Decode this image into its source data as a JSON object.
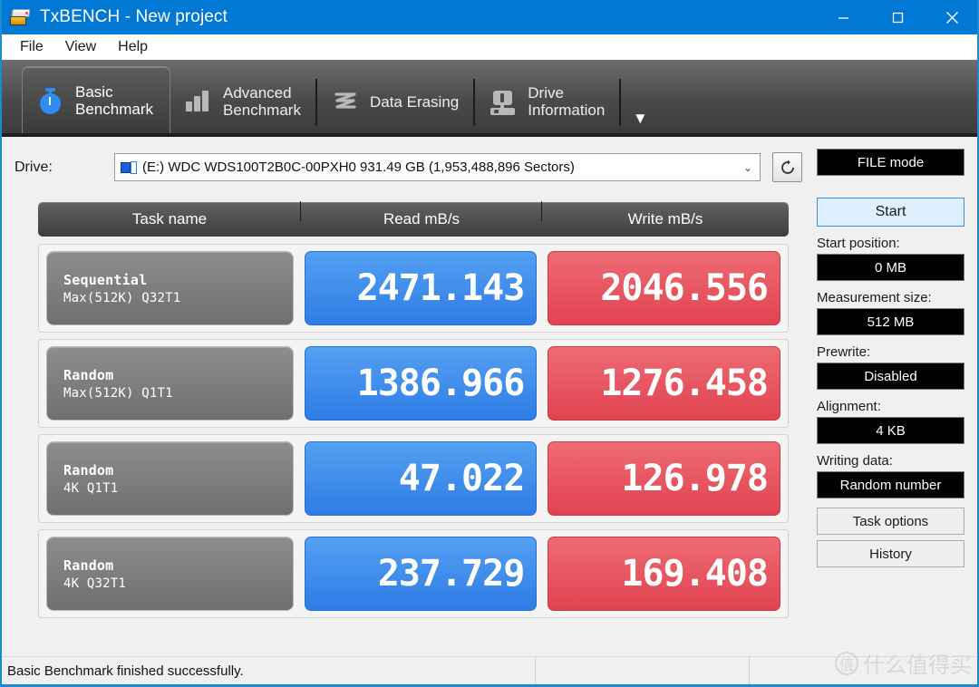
{
  "window": {
    "title": "TxBENCH - New project",
    "app_icon": "drive-icon",
    "controls": {
      "minimize": "minimize-icon",
      "maximize": "maximize-icon",
      "close": "close-icon"
    }
  },
  "menubar": {
    "items": [
      {
        "label": "File"
      },
      {
        "label": "View"
      },
      {
        "label": "Help"
      }
    ]
  },
  "tabs": {
    "items": [
      {
        "label": "Basic\nBenchmark",
        "icon": "stopwatch-icon",
        "active": true
      },
      {
        "label": "Advanced\nBenchmark",
        "icon": "bar-chart-icon",
        "active": false
      },
      {
        "label": "Data Erasing",
        "icon": "eraser-zigzag-icon",
        "active": false
      },
      {
        "label": "Drive\nInformation",
        "icon": "drive-info-icon",
        "active": false
      }
    ],
    "overflow": "▼"
  },
  "drive": {
    "label": "Drive:",
    "selected": "(E:) WDC WDS100T2B0C-00PXH0  931.49 GB (1,953,488,896 Sectors)",
    "caret": "⌄",
    "refresh_icon": "refresh-icon"
  },
  "table": {
    "headers": [
      "Task name",
      "Read mB/s",
      "Write mB/s"
    ],
    "rows": [
      {
        "task_line1": "Sequential",
        "task_line2": "Max(512K) Q32T1",
        "read": "2471.143",
        "write": "2046.556"
      },
      {
        "task_line1": "Random",
        "task_line2": "Max(512K) Q1T1",
        "read": "1386.966",
        "write": "1276.458"
      },
      {
        "task_line1": "Random",
        "task_line2": "4K Q1T1",
        "read": "47.022",
        "write": "126.978"
      },
      {
        "task_line1": "Random",
        "task_line2": "4K Q32T1",
        "read": "237.729",
        "write": "169.408"
      }
    ]
  },
  "sidebar": {
    "mode": "FILE mode",
    "start": "Start",
    "start_position_label": "Start position:",
    "start_position_value": "0 MB",
    "measurement_size_label": "Measurement size:",
    "measurement_size_value": "512 MB",
    "prewrite_label": "Prewrite:",
    "prewrite_value": "Disabled",
    "alignment_label": "Alignment:",
    "alignment_value": "4 KB",
    "writing_data_label": "Writing data:",
    "writing_data_value": "Random number",
    "task_options": "Task options",
    "history": "History"
  },
  "statusbar": {
    "message": "Basic Benchmark finished successfully.",
    "cell2": "",
    "cell3": ""
  },
  "watermark": {
    "mark": "值",
    "text": "什么值得买"
  },
  "colors": {
    "titlebar": "#0078d4",
    "read_blue": "#2f7ce6",
    "write_red": "#e04350",
    "tab_dark": "#4a4a4a",
    "accent_border": "#1a8ad4"
  }
}
